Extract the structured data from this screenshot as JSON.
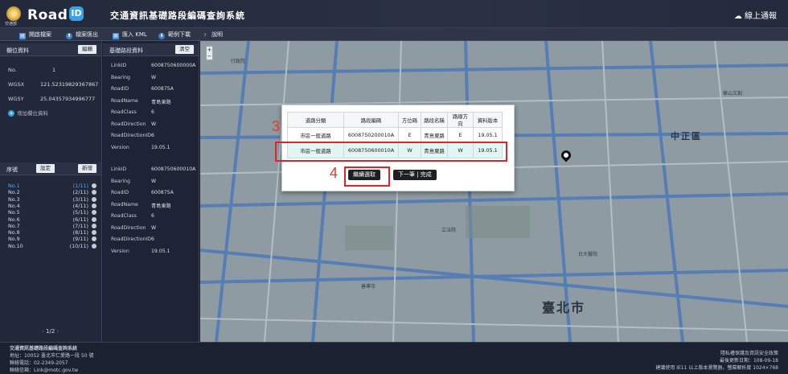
{
  "header": {
    "logo_agency": "交通部",
    "logo_text": "Road",
    "logo_badge": "ID",
    "system_title": "交通資訊基礎路段編碼查詢系統",
    "online_help": "線上通報"
  },
  "toolbar": {
    "items": [
      {
        "label": "開啟檔案",
        "icon": "folder-icon"
      },
      {
        "label": "檔案匯出",
        "icon": "export-icon"
      },
      {
        "label": "匯入 KML",
        "icon": "import-icon"
      },
      {
        "label": "範例下載",
        "icon": "download-icon"
      },
      {
        "label": "說明",
        "icon": "help-icon"
      }
    ]
  },
  "location_panel": {
    "title": "欄位資料",
    "edit_button": "編輯",
    "no_label": "No.",
    "no_value": "1",
    "wgsx_label": "WGSX",
    "wgsx_value": "121.52319829367867",
    "wgsy_label": "WGSY",
    "wgsy_value": "25.04357934996777",
    "add_link": "增加欄位資料"
  },
  "segment_panel": {
    "title": "基礎路段資料",
    "clear_button": "清空",
    "fields": [
      {
        "key": "LinkID",
        "value": "6008750600000A"
      },
      {
        "key": "Bearing",
        "value": "W"
      },
      {
        "key": "RoadID",
        "value": "600875A"
      },
      {
        "key": "RoadName",
        "value": "青島東路"
      },
      {
        "key": "RoadClass",
        "value": "6"
      },
      {
        "key": "RoadDirection",
        "value": "W"
      },
      {
        "key": "RoadDirectionID",
        "value": "6"
      },
      {
        "key": "Version",
        "value": "19.05.1"
      }
    ]
  },
  "list_panel": {
    "title": "序號",
    "settings_button": "設定",
    "add_button": "新增",
    "items": [
      {
        "label": "No.1",
        "count": "(1/11)"
      },
      {
        "label": "No.2",
        "count": "(2/11)"
      },
      {
        "label": "No.3",
        "count": "(3/11)"
      },
      {
        "label": "No.4",
        "count": "(4/11)"
      },
      {
        "label": "No.5",
        "count": "(5/11)"
      },
      {
        "label": "No.6",
        "count": "(6/11)"
      },
      {
        "label": "No.7",
        "count": "(7/11)"
      },
      {
        "label": "No.8",
        "count": "(8/11)"
      },
      {
        "label": "No.9",
        "count": "(9/11)"
      },
      {
        "label": "No.10",
        "count": "(10/11)"
      }
    ],
    "pager": "1/2"
  },
  "detail_panel": {
    "fields": [
      {
        "key": "LinkID",
        "value": "6008750600010A"
      },
      {
        "key": "Bearing",
        "value": "W"
      },
      {
        "key": "RoadID",
        "value": "600875A"
      },
      {
        "key": "RoadName",
        "value": "青島東路"
      },
      {
        "key": "RoadClass",
        "value": "6"
      },
      {
        "key": "RoadDirection",
        "value": "W"
      },
      {
        "key": "RoadDirectionID",
        "value": "6"
      },
      {
        "key": "Version",
        "value": "19.05.1"
      }
    ]
  },
  "modal": {
    "headers": [
      "道路分類",
      "路段編碼",
      "方位碼",
      "路段名稱",
      "路線方向",
      "資料版本"
    ],
    "rows": [
      [
        "市區一般道路",
        "6008750200010A",
        "E",
        "青島東路",
        "E",
        "19.05.1"
      ],
      [
        "市區一般道路",
        "6008750600010A",
        "W",
        "青島東路",
        "W",
        "19.05.1"
      ]
    ],
    "step3": "3",
    "step4": "4",
    "continue_button": "繼續選取",
    "next_button": "下一筆 | 完成"
  },
  "map": {
    "labels": [
      "中正區",
      "臺北市",
      "行政院",
      "立法院",
      "善導寺",
      "台大醫院",
      "華山文創"
    ]
  },
  "footer": {
    "org": "交通資訊基礎路段編碼查詢系統",
    "address": "地址：10052 臺北市仁愛路一段 50 號",
    "phone": "聯絡電話：02-2349-2057",
    "email": "聯絡信箱：Link@motc.gov.tw",
    "right1": "隱私權保護及資訊安全政策",
    "right2": "最後更新日期：108-09-18",
    "right3": "建議使用 IE11 以上版本瀏覽器，螢幕解析度 1024×768"
  }
}
